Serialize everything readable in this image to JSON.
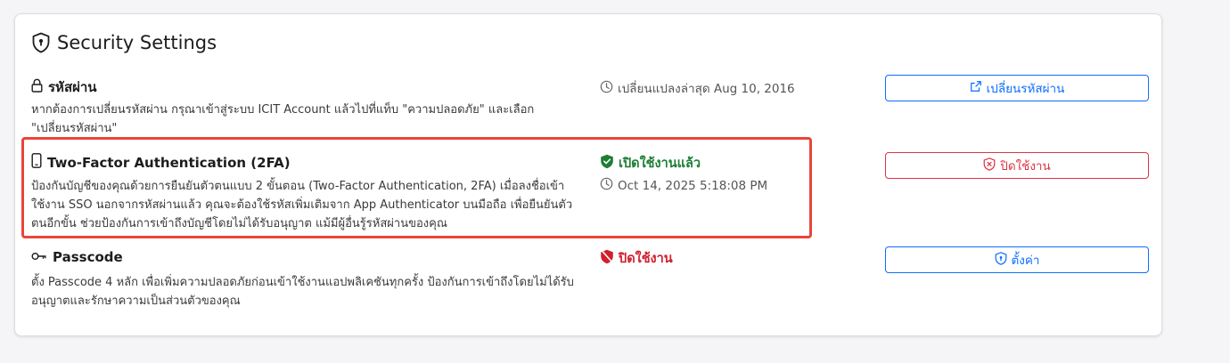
{
  "card": {
    "title": "Security Settings",
    "title_icon": "shield-icon"
  },
  "password": {
    "icon": "lock-icon",
    "title": "รหัสผ่าน",
    "description": "หากต้องการเปลี่ยนรหัสผ่าน กรุณาเข้าสู่ระบบ ICIT Account แล้วไปที่แท็บ \"ความปลอดภัย\" และเลือก \"เปลี่ยนรหัสผ่าน\"",
    "status_icon": "clock-icon",
    "status": "เปลี่ยนแปลงล่าสุด Aug 10, 2016",
    "button_icon": "external-link-icon",
    "button_label": "เปลี่ยนรหัสผ่าน"
  },
  "twofa": {
    "icon": "mobile-phone-icon",
    "title": "Two-Factor Authentication (2FA)",
    "description": "ป้องกันบัญชีของคุณด้วยการยืนยันตัวตนแบบ 2 ขั้นตอน (Two-Factor Authentication, 2FA) เมื่อลงชื่อเข้าใช้งาน SSO นอกจากรหัสผ่านแล้ว คุณจะต้องใช้รหัสเพิ่มเติมจาก App Authenticator บนมือถือ เพื่อยืนยันตัวตนอีกขั้น ช่วยป้องกันการเข้าถึงบัญชีโดยไม่ได้รับอนุญาต แม้มีผู้อื่นรู้รหัสผ่านของคุณ",
    "status_icon": "shield-check-icon",
    "status": "เปิดใช้งานแล้ว",
    "timestamp_icon": "clock-icon",
    "timestamp": "Oct 14, 2025 5:18:08 PM",
    "button_icon": "shield-x-icon",
    "button_label": "ปิดใช้งาน",
    "highlight_color": "#e9453a"
  },
  "passcode": {
    "icon": "key-icon",
    "title": "Passcode",
    "description": "ตั้ง Passcode 4 หลัก เพื่อเพิ่มความปลอดภัยก่อนเข้าใช้งานแอปพลิเคชันทุกครั้ง ป้องกันการเข้าถึงโดยไม่ได้รับอนุญาตและรักษาความเป็นส่วนตัวของคุณ",
    "status_icon": "shield-slash-icon",
    "status": "ปิดใช้งาน",
    "button_icon": "shield-lock-icon",
    "button_label": "ตั้งค่า"
  },
  "colors": {
    "primary": "#0d6efd",
    "success": "#1e7e34",
    "danger": "#dc3545"
  }
}
